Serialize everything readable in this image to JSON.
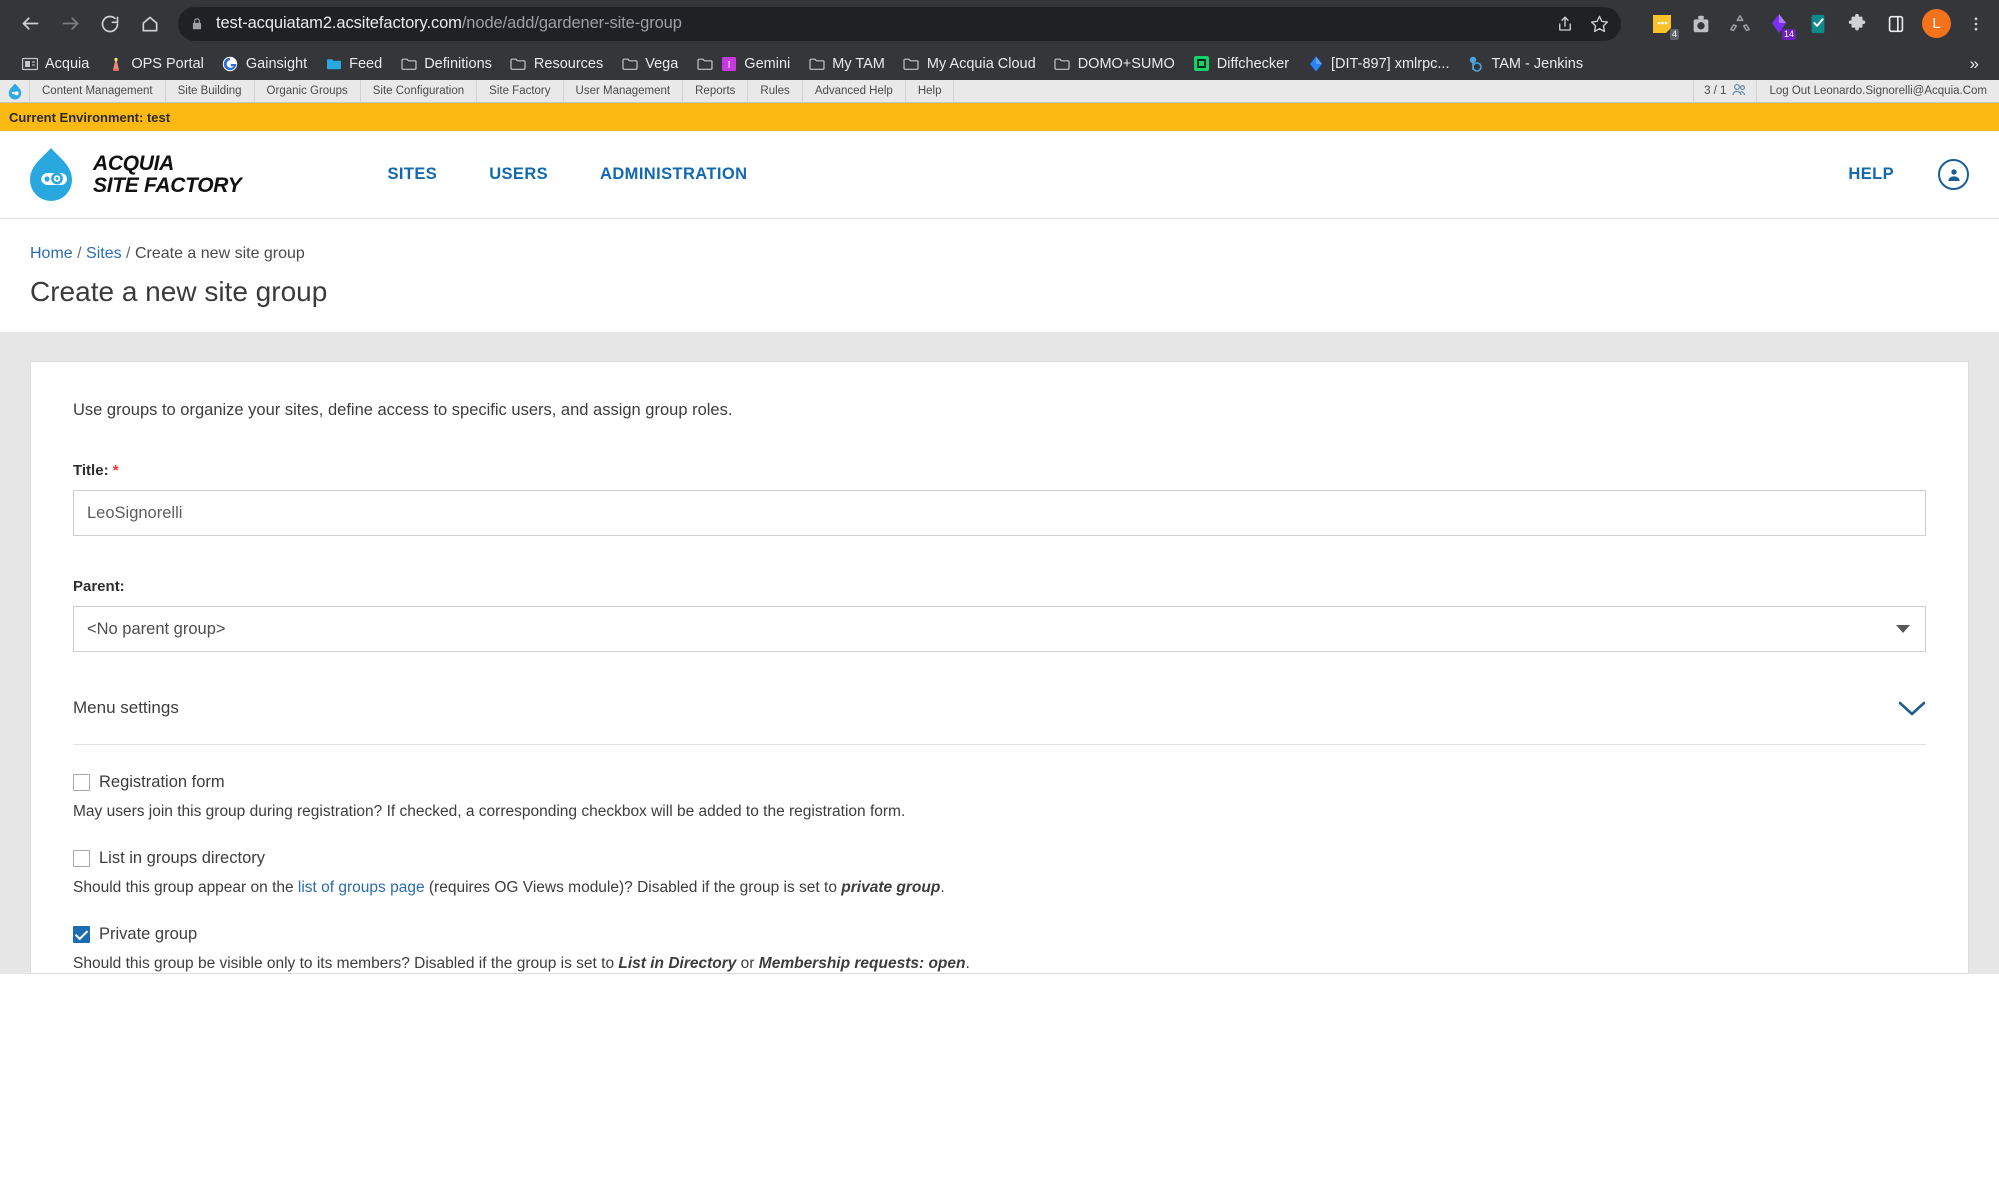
{
  "browser": {
    "url_host": "test-acquiatam2.acsitefactory.com",
    "url_path": "/node/add/gardener-site-group",
    "nav": {
      "back": "back-arrow",
      "forward": "forward-arrow",
      "reload": "reload",
      "home": "home"
    },
    "omni_actions": [
      "share-icon",
      "bookmark-star-icon"
    ],
    "extensions": [
      {
        "name": "sticky-notes-extension",
        "badge": "4"
      },
      {
        "name": "camera-extension",
        "badge": ""
      },
      {
        "name": "recycle-extension",
        "badge": ""
      },
      {
        "name": "diamond-extension",
        "badge": "14"
      },
      {
        "name": "grammar-check-extension",
        "badge": ""
      },
      {
        "name": "puzzle-extensions-icon",
        "badge": ""
      },
      {
        "name": "side-panel-icon",
        "badge": ""
      }
    ],
    "profile_initial": "L",
    "menu_icon": "kebab-menu-icon",
    "bookmarks": [
      {
        "label": "Acquia",
        "icon": "reader-icon"
      },
      {
        "label": "OPS Portal",
        "icon": "lighthouse-icon"
      },
      {
        "label": "Gainsight",
        "icon": "gainsight-icon"
      },
      {
        "label": "Feed",
        "icon": "blue-folder-icon"
      },
      {
        "label": "Definitions",
        "icon": "folder-icon"
      },
      {
        "label": "Resources",
        "icon": "folder-icon"
      },
      {
        "label": "Vega",
        "icon": "folder-icon"
      },
      {
        "label": "Gemini",
        "icon": "gemini-icon"
      },
      {
        "label": "My TAM",
        "icon": "folder-icon"
      },
      {
        "label": "My Acquia Cloud",
        "icon": "folder-icon"
      },
      {
        "label": "DOMO+SUMO",
        "icon": "folder-icon"
      },
      {
        "label": "Diffchecker",
        "icon": "diffchecker-icon"
      },
      {
        "label": "[DIT-897] xmlrpc...",
        "icon": "jira-icon"
      },
      {
        "label": "TAM - Jenkins",
        "icon": "jenkins-icon"
      }
    ],
    "bookmarks_overflow": "»"
  },
  "admin_toolbar": {
    "logo": "drupal-drop-icon",
    "items": [
      "Content Management",
      "Site Building",
      "Organic Groups",
      "Site Configuration",
      "Site Factory",
      "User Management",
      "Reports",
      "Rules",
      "Advanced Help",
      "Help"
    ],
    "user_count": "3 / 1",
    "user_icon": "users-icon",
    "logout": "Log Out Leonardo.Signorelli@Acquia.Com"
  },
  "env_bar": {
    "text": "Current Environment: test",
    "color": "#fdb913"
  },
  "site_header": {
    "logo_line1": "ACQUIA",
    "logo_line2": "SITE FACTORY",
    "nav": [
      "SITES",
      "USERS",
      "ADMINISTRATION"
    ],
    "help": "HELP",
    "account_icon": "user-account-icon",
    "link_color": "#1269b0"
  },
  "page": {
    "breadcrumb": [
      {
        "label": "Home",
        "link": true
      },
      {
        "label": "Sites",
        "link": true
      },
      {
        "label": "Create a new site group",
        "link": false
      }
    ],
    "breadcrumb_separator": "/",
    "title": "Create a new site group"
  },
  "form": {
    "intro": "Use groups to organize your sites, define access to specific users, and assign group roles.",
    "title_field": {
      "label": "Title:",
      "required_mark": "*",
      "value": "LeoSignorelli",
      "placeholder": ""
    },
    "parent_field": {
      "label": "Parent:",
      "selected": "<No parent group>",
      "options": [
        "<No parent group>"
      ]
    },
    "menu_settings": {
      "label": "Menu settings",
      "icon": "chevron-down-icon",
      "expanded": false
    },
    "checkboxes": [
      {
        "label": "Registration form",
        "checked": false,
        "help_prefix": "May users join this group during registration? If checked, a corresponding checkbox will be added to the registration form.",
        "help_link": "",
        "help_mid": "",
        "help_em1": "",
        "help_mid2": "",
        "help_em2": "",
        "help_suffix": ""
      },
      {
        "label": "List in groups directory",
        "checked": false,
        "help_prefix": "Should this group appear on the ",
        "help_link": "list of groups page",
        "help_mid": " (requires OG Views module)? Disabled if the group is set to ",
        "help_em1": "private group",
        "help_mid2": "",
        "help_em2": "",
        "help_suffix": "."
      },
      {
        "label": "Private group",
        "checked": true,
        "help_prefix": "Should this group be visible only to its members? Disabled if the group is set to ",
        "help_link": "",
        "help_mid": "",
        "help_em1": "List in Directory",
        "help_mid2": " or ",
        "help_em2": "Membership requests: open",
        "help_suffix": "."
      }
    ]
  }
}
